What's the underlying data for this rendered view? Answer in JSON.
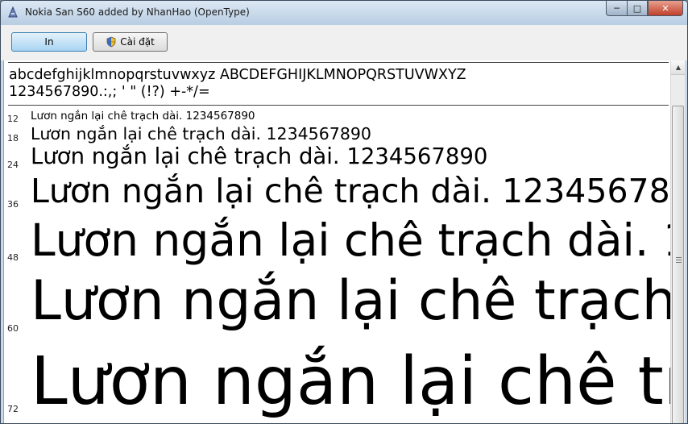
{
  "window": {
    "title": "Nokia San S60 added by NhanHao (OpenType)"
  },
  "toolbar": {
    "print_label": "In",
    "install_label": "Cài đặt"
  },
  "preview": {
    "charset_line1": "abcdefghijklmnopqrstuvwxyz ABCDEFGHIJKLMNOPQRSTUVWXYZ",
    "charset_line2": "1234567890.:,; ' \" (!?) +-*/=",
    "sample_text": "Lươn ngắn lại chê trạch dài. 1234567890",
    "samples": [
      {
        "size": "12"
      },
      {
        "size": "18"
      },
      {
        "size": "24"
      },
      {
        "size": "36"
      },
      {
        "size": "48"
      },
      {
        "size": "60"
      },
      {
        "size": "72"
      }
    ]
  },
  "colors": {
    "accent": "#a8d4f2",
    "close": "#c0402a",
    "titlebar": "#c9d9ea"
  },
  "icons": {
    "app": "font-icon",
    "install": "uac-shield-icon"
  }
}
